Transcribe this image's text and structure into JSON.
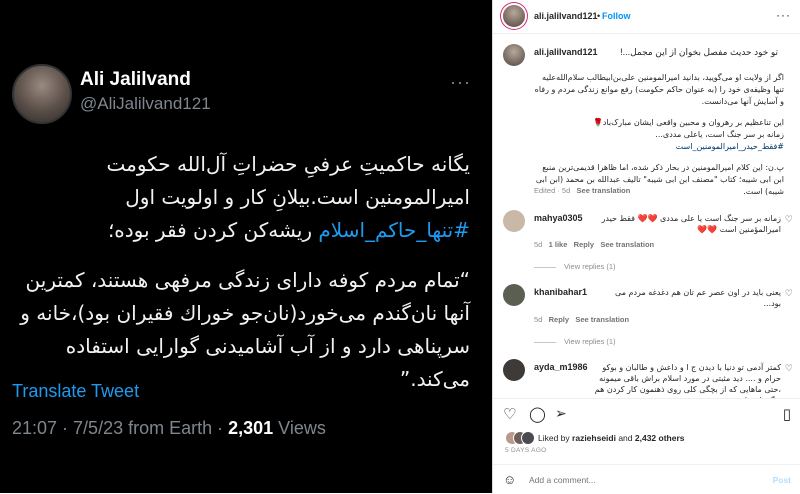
{
  "tweet": {
    "name": "Ali Jalilvand",
    "handle": "@AliJalilvand121",
    "more": "···",
    "para1_a": "یگانه حاکمیتِ عرفیِ حضراتِ آل‌الله حکومت امیرالمومنین است.بیلانِ کار و اولویت اول ",
    "para1_tag": "#تنها_حاکم_اسلام",
    "para1_b": " ریشه‌کن کردن فقر بوده؛",
    "para2": "“تمام مردم کوفه دارای زندگی مرفهی هستند، کمترین آنها نان‌گندم می‌خورد(نان‌جو خوراك فقیران بود)،خانه و سرپناهی دارد و از آب آشامیدنی گوارایی استفاده می‌کند.”",
    "translate": "Translate Tweet",
    "meta": "21:07 · 7/5/23 from Earth · ",
    "views_count": "2,301",
    "views_label": " Views"
  },
  "instagram": {
    "username": "ali.jalilvand121",
    "follow": "Follow",
    "dot": "•",
    "more": "···",
    "caption_line1": "تو خود حدیث مفصل بخوان از این مجمل...!",
    "caption_p1": "اگر از ولایت او می‌گویید، بدانید امیرالمومنین علی‌بن‌ابیطالب سلام‌الله‌علیه تنها وظیفه‌ی خود را (به عنوان حاکم حکومت) رفع موانع زندگی مردم و رفاه و آسایش آنها می‌دانست.",
    "caption_p2": "این تناعظیم بر رهروان و محبین واقعی ایشان مبارک‌باد🌹",
    "caption_p3": "زمانه بر سر جنگ است، یاعلی مددی...",
    "caption_tag": "#فقط_حیدر_امیرالمومنین_است",
    "caption_p4": "پ.ن: این کلام امیرالمومنین در بحار ذکر شده، اما ظاهرا قدیمی‌ترین منبع ابن ابی شیبه؛ کتاب \"مصنف ابن ابی شیبه\" تالیف عبدالله بن محمد (ابن ابی شیبه) است.",
    "caption_meta_time": "Edited · 5d",
    "caption_meta_translate": "See translation",
    "comments": [
      {
        "user": "mahya0305",
        "text": "زمانه بر سر جنگ است یا علی مددی ❤️❤️ فقط حیدر امیرالمؤمنین است ❤️❤️",
        "time": "5d",
        "likes": "1 like",
        "reply": "Reply",
        "translate": "See translation",
        "view_replies": "View replies (1)",
        "avatar_color": "#c9b8a6"
      },
      {
        "user": "khanibahar1",
        "text": "یعنی باید در اون عصر عم تان هم دغدغه مردم می بود...",
        "time": "5d",
        "reply": "Reply",
        "translate": "See translation",
        "view_replies": "View replies (1)",
        "avatar_color": "#5b5f52"
      },
      {
        "user": "ayda_m1986",
        "text": "کمتر آدمی تو دنیا با دیدن ج ا و داعش و طالبان و بوکو حرام و .... دید مثبتی در مورد اسلام براش باقی میمونه ،حتی ماهایی که از بچگی کلی روی ذهنمون کار کردن هم دیگه باورهامون عوض",
        "avatar_color": "#3d3a38"
      }
    ],
    "liked_by_prefix": "Liked by ",
    "liked_by_user": "raziehseidi",
    "liked_by_and": " and ",
    "liked_by_count": "2,432 others",
    "days_ago": "5 DAYS AGO",
    "comment_placeholder": "Add a comment...",
    "post_label": "Post"
  },
  "colors": {
    "twitter_blue": "#1d9bf0",
    "instagram_blue": "#0095f6",
    "post_disabled": "#b2dffc"
  },
  "icons": [
    "heart-icon",
    "comment-icon",
    "share-icon",
    "bookmark-icon",
    "emoji-icon",
    "more-icon"
  ]
}
